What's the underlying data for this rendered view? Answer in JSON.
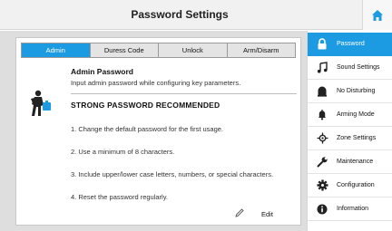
{
  "header": {
    "title": "Password Settings",
    "home_icon": "home-icon"
  },
  "tabs": [
    {
      "label": "Admin",
      "active": true
    },
    {
      "label": "Duress Code",
      "active": false
    },
    {
      "label": "Unlock",
      "active": false
    },
    {
      "label": "Arm/Disarm",
      "active": false
    }
  ],
  "content": {
    "section_title": "Admin Password",
    "section_desc": "Input admin password while configuring key parameters.",
    "strong_heading": "STRONG PASSWORD RECOMMENDED",
    "tips": [
      "1. Change the default password for the first usage.",
      "2. Use a minimum of 8 characters.",
      "3. Include upper/lower case letters, numbers, or special characters.",
      "4. Reset the password regularly."
    ],
    "edit_label": "Edit"
  },
  "sidebar": {
    "items": [
      {
        "label": "Password",
        "icon": "lock-icon",
        "active": true
      },
      {
        "label": "Sound Settings",
        "icon": "music-note-icon",
        "active": false
      },
      {
        "label": "No Disturbing",
        "icon": "alarm-off-icon",
        "active": false
      },
      {
        "label": "Arming Mode",
        "icon": "bell-icon",
        "active": false
      },
      {
        "label": "Zone Settings",
        "icon": "zone-icon",
        "active": false
      },
      {
        "label": "Maintenance",
        "icon": "wrench-icon",
        "active": false
      },
      {
        "label": "Configuration",
        "icon": "gear-icon",
        "active": false
      },
      {
        "label": "Information",
        "icon": "info-icon",
        "active": false
      }
    ]
  },
  "colors": {
    "accent": "#1d9be2",
    "background": "#dedede"
  }
}
